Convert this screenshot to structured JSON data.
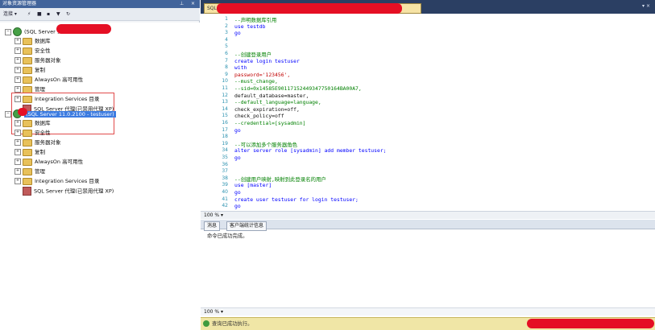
{
  "explorer": {
    "title": "对象资源管理器",
    "toolbar": {
      "connect": "连接 ▾"
    },
    "tree": [
      {
        "label": "(SQL Server 11.0.2100",
        "type": "server"
      },
      {
        "label": "数据库",
        "type": "folder"
      },
      {
        "label": "安全性",
        "type": "folder"
      },
      {
        "label": "服务器对象",
        "type": "folder"
      },
      {
        "label": "复制",
        "type": "folder"
      },
      {
        "label": "AlwaysOn 高可用性",
        "type": "folder"
      },
      {
        "label": "管理",
        "type": "folder"
      },
      {
        "label": "Integration Services 目录",
        "type": "folder"
      },
      {
        "label": "SQL Server 代理(已禁用代理 XP)",
        "type": "agent"
      },
      {
        "label": "(SQL Server 11.0.2100 - testuser)",
        "type": "server"
      },
      {
        "label": "数据库",
        "type": "folder"
      },
      {
        "label": "安全性",
        "type": "folder"
      },
      {
        "label": "服务器对象",
        "type": "folder"
      },
      {
        "label": "复制",
        "type": "folder"
      },
      {
        "label": "AlwaysOn 高可用性",
        "type": "folder"
      },
      {
        "label": "管理",
        "type": "folder"
      },
      {
        "label": "Integration Services 目录",
        "type": "folder"
      },
      {
        "label": "SQL Server 代理(已禁用代理 XP)",
        "type": "agent"
      }
    ]
  },
  "editor": {
    "tab_title": "SQLQuery1.sql",
    "zoom": "100 %",
    "lines": [
      {
        "n": "1",
        "t": "--声明数据库引用"
      },
      {
        "n": "2",
        "t": "use testdb"
      },
      {
        "n": "3",
        "t": "go"
      },
      {
        "n": "4",
        "t": ""
      },
      {
        "n": "5",
        "t": ""
      },
      {
        "n": "6",
        "t": "--创建登录用户"
      },
      {
        "n": "7",
        "t": "create login testuser"
      },
      {
        "n": "8",
        "t": "with"
      },
      {
        "n": "9",
        "t": "password='123456',"
      },
      {
        "n": "10",
        "t": "--must_change,"
      },
      {
        "n": "11",
        "t": "--sid=0x14585E90117152449347750164BA00A7,"
      },
      {
        "n": "12",
        "t": "default_database=master,"
      },
      {
        "n": "13",
        "t": "--default_language=language,"
      },
      {
        "n": "14",
        "t": "check_expiration=off,"
      },
      {
        "n": "15",
        "t": "check_policy=off"
      },
      {
        "n": "16",
        "t": "--credential=[sysadmin]"
      },
      {
        "n": "17",
        "t": "go"
      },
      {
        "n": "18",
        "t": ""
      },
      {
        "n": "19",
        "t": "--可以添加多个服务器角色"
      },
      {
        "n": "34",
        "t": "alter server role [sysadmin] add member testuser;"
      },
      {
        "n": "35",
        "t": "go"
      },
      {
        "n": "36",
        "t": ""
      },
      {
        "n": "37",
        "t": ""
      },
      {
        "n": "38",
        "t": "--创建用户映射,映射到此登录名的用户"
      },
      {
        "n": "39",
        "t": "use [master]"
      },
      {
        "n": "40",
        "t": "go"
      },
      {
        "n": "41",
        "t": "create user testuser for login testuser;"
      },
      {
        "n": "42",
        "t": "go"
      }
    ]
  },
  "results": {
    "tab_messages": "消息",
    "tab_stats": "客户端统计信息",
    "message": "命令已成功完成。",
    "zoom": "100 %"
  },
  "status": {
    "text": "查询已成功执行。"
  },
  "colors": {
    "titlebar": "#42649b",
    "editor_header": "#2b3f63",
    "statusbar": "#f0e6a6",
    "keyword": "#0000ff",
    "comment": "#008000",
    "string": "#c00000"
  }
}
